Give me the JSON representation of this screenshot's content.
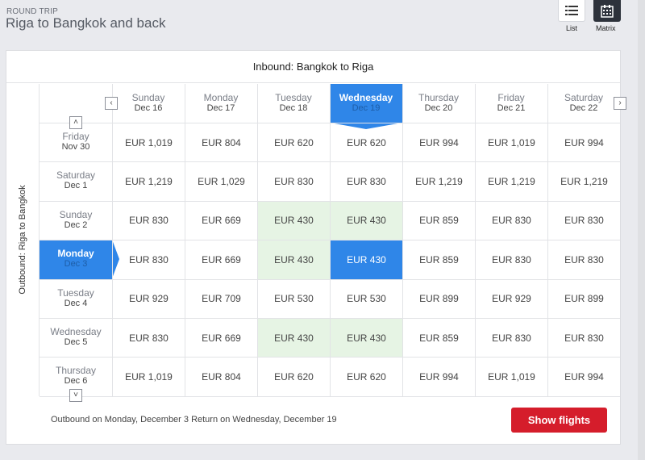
{
  "header": {
    "trip_type": "ROUND TRIP",
    "title": "Riga to Bangkok and back"
  },
  "views": {
    "list_label": "List",
    "list_icon": "list-icon",
    "matrix_label": "Matrix",
    "matrix_icon": "calendar-icon"
  },
  "matrix": {
    "inbound_title": "Inbound: Bangkok to Riga",
    "outbound_title": "Outbound: Riga to Bangkok",
    "columns": [
      {
        "day": "Sunday",
        "date": "Dec 16"
      },
      {
        "day": "Monday",
        "date": "Dec 17"
      },
      {
        "day": "Tuesday",
        "date": "Dec 18"
      },
      {
        "day": "Wednesday",
        "date": "Dec 19"
      },
      {
        "day": "Thursday",
        "date": "Dec 20"
      },
      {
        "day": "Friday",
        "date": "Dec 21"
      },
      {
        "day": "Saturday",
        "date": "Dec 22"
      }
    ],
    "rows": [
      {
        "day": "Friday",
        "date": "Nov 30",
        "prices": [
          "EUR 1,019",
          "EUR 804",
          "EUR 620",
          "EUR 620",
          "EUR 994",
          "EUR 1,019",
          "EUR 994"
        ]
      },
      {
        "day": "Saturday",
        "date": "Dec 1",
        "prices": [
          "EUR 1,219",
          "EUR 1,029",
          "EUR 830",
          "EUR 830",
          "EUR 1,219",
          "EUR 1,219",
          "EUR 1,219"
        ]
      },
      {
        "day": "Sunday",
        "date": "Dec 2",
        "prices": [
          "EUR 830",
          "EUR 669",
          "EUR 430",
          "EUR 430",
          "EUR 859",
          "EUR 830",
          "EUR 830"
        ]
      },
      {
        "day": "Monday",
        "date": "Dec 3",
        "prices": [
          "EUR 830",
          "EUR 669",
          "EUR 430",
          "EUR 430",
          "EUR 859",
          "EUR 830",
          "EUR 830"
        ]
      },
      {
        "day": "Tuesday",
        "date": "Dec 4",
        "prices": [
          "EUR 929",
          "EUR 709",
          "EUR 530",
          "EUR 530",
          "EUR 899",
          "EUR 929",
          "EUR 899"
        ]
      },
      {
        "day": "Wednesday",
        "date": "Dec 5",
        "prices": [
          "EUR 830",
          "EUR 669",
          "EUR 430",
          "EUR 430",
          "EUR 859",
          "EUR 830",
          "EUR 830"
        ]
      },
      {
        "day": "Thursday",
        "date": "Dec 6",
        "prices": [
          "EUR 1,019",
          "EUR 804",
          "EUR 620",
          "EUR 620",
          "EUR 994",
          "EUR 1,019",
          "EUR 994"
        ]
      }
    ],
    "selected_row": 3,
    "selected_col": 3,
    "cheapest_cells": [
      [
        2,
        2
      ],
      [
        2,
        3
      ],
      [
        3,
        2
      ],
      [
        5,
        2
      ],
      [
        5,
        3
      ]
    ],
    "nav": {
      "prev_icon": "chevron-left-icon",
      "next_icon": "chevron-right-icon",
      "up_icon": "chevron-up-icon",
      "down_icon": "chevron-down-icon"
    }
  },
  "footer": {
    "summary": "Outbound on Monday, December 3 Return on Wednesday, December 19",
    "show_flights": "Show flights"
  },
  "colors": {
    "selected": "#2f86e8",
    "cheapest": "#e6f4e4",
    "cta": "#d51d2b"
  }
}
